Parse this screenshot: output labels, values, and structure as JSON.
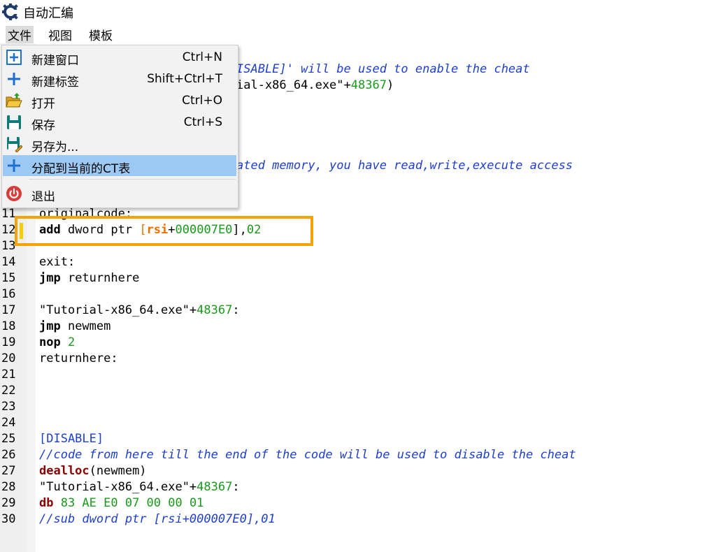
{
  "window": {
    "title": "自动汇编"
  },
  "menubar": {
    "file": "文件",
    "view": "视图",
    "template": "模板"
  },
  "dropdown": {
    "items": [
      {
        "label": "新建窗口",
        "shortcut": "Ctrl+N",
        "icon": "window-plus-icon"
      },
      {
        "label": "新建标签",
        "shortcut": "Shift+Ctrl+T",
        "icon": "plus-icon"
      },
      {
        "label": "打开",
        "shortcut": "Ctrl+O",
        "icon": "folder-open-icon"
      },
      {
        "label": "保存",
        "shortcut": "Ctrl+S",
        "icon": "floppy-disk-icon"
      },
      {
        "label": "另存为...",
        "shortcut": "",
        "icon": "floppy-edit-icon"
      },
      {
        "label": "分配到当前的CT表",
        "shortcut": "",
        "icon": "plus-icon",
        "selected": true
      },
      {
        "label": "退出",
        "shortcut": "",
        "icon": "power-icon"
      }
    ]
  },
  "editor": {
    "visible_fragments": {
      "line1_tail": "ISABLE]' will be used to enable the cheat",
      "line2_tail_a": "ial-x86_64.exe\"+",
      "line2_tail_num": "48367",
      "line2_tail_b": ")",
      "line7_tail": "ated memory, you have read,write,execute access",
      "line11_partial": "originalcode:"
    },
    "line_numbers": [
      "11",
      "12",
      "13",
      "14",
      "15",
      "16",
      "17",
      "18",
      "19",
      "20",
      "21",
      "22",
      "23",
      "24",
      "25",
      "26",
      "27",
      "28",
      "29",
      "30"
    ],
    "lines": {
      "l12": {
        "kw": "add",
        "mid": " dword ptr ",
        "ob": "[",
        "reg": "rsi",
        "plus": "+",
        "off": "000007E0",
        "cb": "]",
        "comma": ",",
        "val": "02"
      },
      "l14": "exit:",
      "l15": {
        "kw": "jmp",
        "rest": " returnhere"
      },
      "l17": {
        "str": "\"Tutorial-x86_64.exe\"+",
        "num": "48367",
        "colon": ":"
      },
      "l18": {
        "kw": "jmp",
        "rest": " newmem"
      },
      "l19": {
        "kw": "nop",
        "num": " 2"
      },
      "l20": "returnhere:",
      "l25": "[DISABLE]",
      "l26": "//code from here till the end of the code will be used to disable the cheat",
      "l27": {
        "kw": "dealloc",
        "rest": "(newmem)"
      },
      "l28": {
        "str": "\"Tutorial-x86_64.exe\"+",
        "num": "48367",
        "colon": ":"
      },
      "l29": {
        "kw": "db",
        "bytes": " 83 AE E0 07 00 00 01"
      },
      "l30": "//sub dword ptr [rsi+000007E0],01"
    }
  },
  "colors": {
    "keyword_red": "#8b0000",
    "number_green": "#1a9a1a",
    "register_orange": "#e67300",
    "comment_blue": "#1e3fcc",
    "menu_selected": "#9cc9f3",
    "highlight_box": "#f5a300"
  }
}
